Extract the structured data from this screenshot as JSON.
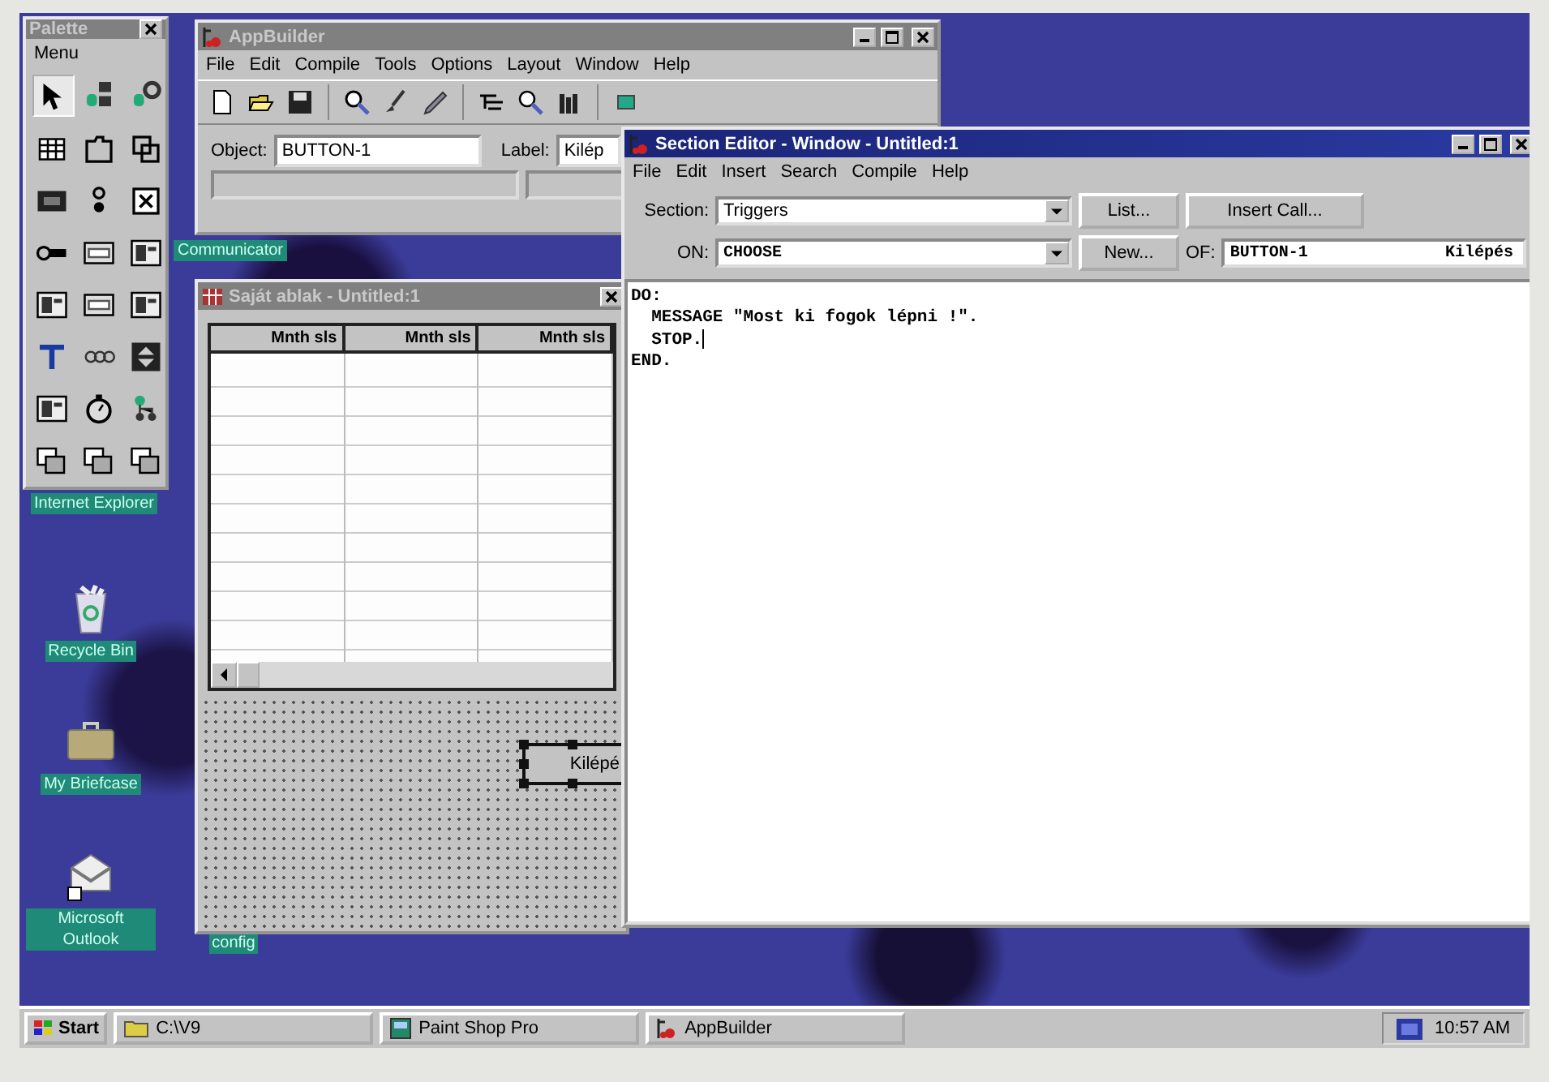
{
  "palette": {
    "title": "Palette",
    "active": false,
    "menu": "Menu"
  },
  "appbuilder": {
    "title": "AppBuilder",
    "active": false,
    "menu": [
      "File",
      "Edit",
      "Compile",
      "Tools",
      "Options",
      "Layout",
      "Window",
      "Help"
    ],
    "object_label": "Object:",
    "object_value": "BUTTON-1",
    "label_label": "Label:",
    "label_value": "Kilép"
  },
  "desktop_icons": [
    {
      "label": "Communicator",
      "kind": "hidden"
    },
    {
      "label": "Internet Explorer",
      "kind": "hidden"
    },
    {
      "label": "Recycle Bin",
      "kind": "recycle-bin"
    },
    {
      "label": "My Briefcase",
      "kind": "briefcase"
    },
    {
      "label": "Microsoft Outlook",
      "kind": "outlook"
    },
    {
      "label": "config",
      "kind": "hidden"
    }
  ],
  "form_window": {
    "title": "Saját ablak - Untitled:1",
    "active": false,
    "columns": [
      "Mnth sls",
      "Mnth sls",
      "Mnth sls"
    ],
    "button_label": "Kilépé"
  },
  "editor": {
    "title": "Section Editor - Window - Untitled:1",
    "active": true,
    "menu": [
      "File",
      "Edit",
      "Insert",
      "Search",
      "Compile",
      "Help"
    ],
    "section_label": "Section:",
    "section_value": "Triggers",
    "on_label": "ON:",
    "on_value": "CHOOSE",
    "of_label": "OF:",
    "of_value": "BUTTON-1",
    "of_extra": "Kilépés",
    "list_button": "List...",
    "insert_button": "Insert Call...",
    "new_button": "New...",
    "code": [
      "DO:",
      "  MESSAGE \"Most ki fogok lépni !\".",
      "  STOP.",
      "END."
    ]
  },
  "taskbar": {
    "start": "Start",
    "tasks": [
      "C:\\V9",
      "Paint Shop Pro",
      "AppBuilder"
    ],
    "clock": "10:57 AM"
  }
}
